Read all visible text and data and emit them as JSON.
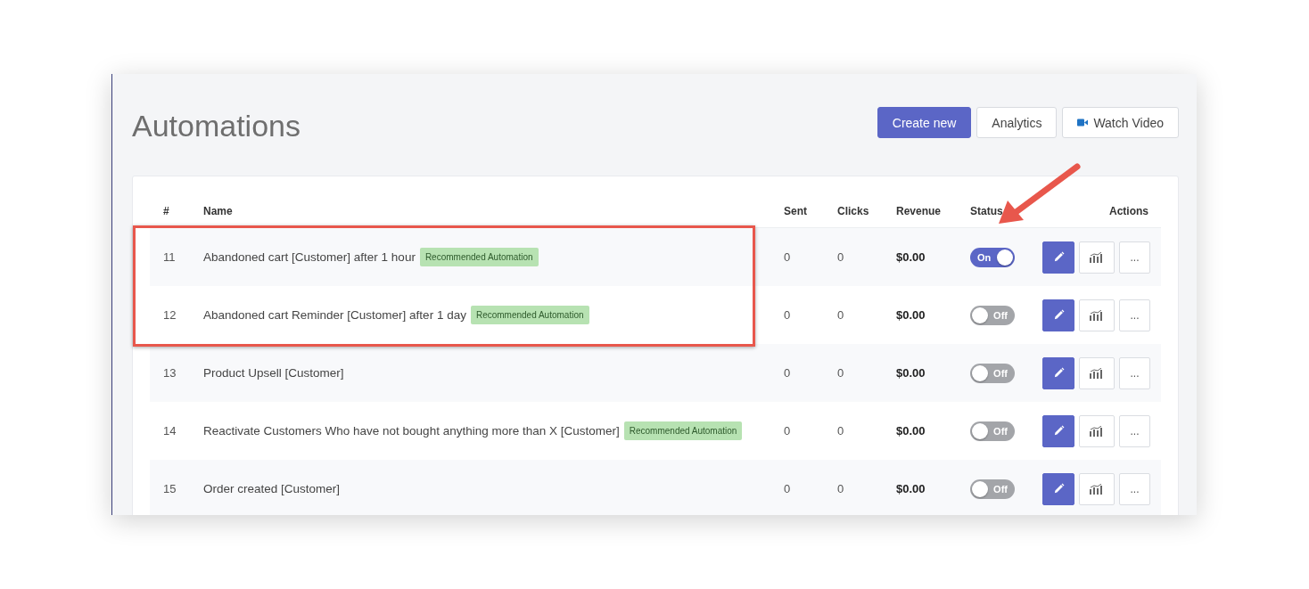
{
  "page": {
    "title": "Automations"
  },
  "toolbar": [
    {
      "kind": "primary",
      "label": "Create new"
    },
    {
      "kind": "plain",
      "label": "Analytics"
    },
    {
      "kind": "video",
      "label": "Watch Video"
    }
  ],
  "table": {
    "columns": [
      "#",
      "Name",
      "Sent",
      "Clicks",
      "Revenue",
      "Status",
      "Actions"
    ],
    "rows": [
      {
        "id": "11",
        "name": "Abandoned cart [Customer] after 1 hour",
        "badge": "Recommended Automation",
        "sent": "0",
        "clicks": "0",
        "revenue": "$0.00",
        "on": true,
        "toggle_label": "On",
        "highlighted": true,
        "more": "..."
      },
      {
        "id": "12",
        "name": "Abandoned cart Reminder [Customer] after 1 day",
        "badge": "Recommended Automation",
        "sent": "0",
        "clicks": "0",
        "revenue": "$0.00",
        "on": false,
        "toggle_label": "Off",
        "highlighted": true,
        "more": "..."
      },
      {
        "id": "13",
        "name": "Product Upsell [Customer]",
        "sent": "0",
        "clicks": "0",
        "revenue": "$0.00",
        "on": false,
        "toggle_label": "Off",
        "highlighted": false,
        "more": "..."
      },
      {
        "id": "14",
        "name": "Reactivate Customers Who have not bought anything more than X [Customer]",
        "badge": "Recommended Automation",
        "sent": "0",
        "clicks": "0",
        "revenue": "$0.00",
        "on": false,
        "toggle_label": "Off",
        "highlighted": false,
        "more": "..."
      },
      {
        "id": "15",
        "name": "Order created [Customer]",
        "sent": "0",
        "clicks": "0",
        "revenue": "$0.00",
        "on": false,
        "toggle_label": "Off",
        "highlighted": false,
        "more": "..."
      }
    ]
  }
}
